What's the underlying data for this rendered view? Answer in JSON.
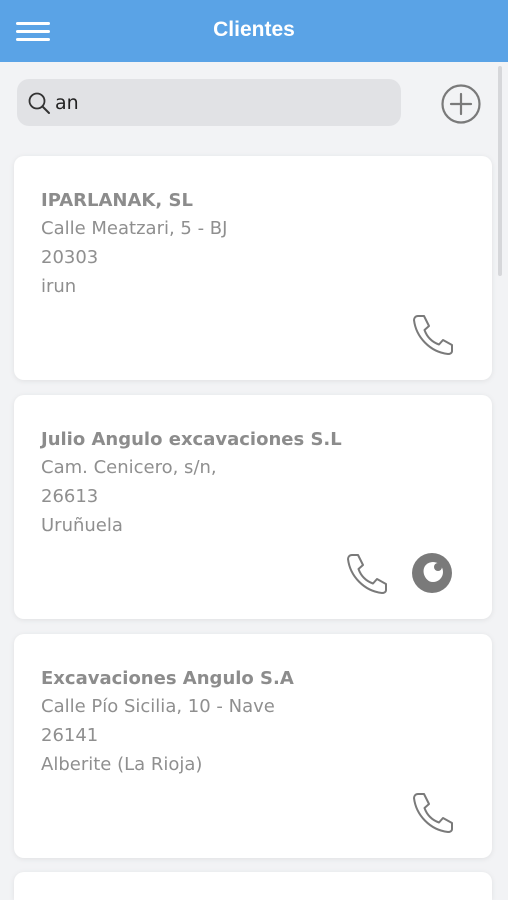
{
  "header": {
    "title": "Clientes",
    "menu_icon": "hamburger-menu-icon"
  },
  "search": {
    "value": "an",
    "icon": "search-icon"
  },
  "add_icon": "plus-circle-icon",
  "clients": [
    {
      "name": "IPARLANAK, SL",
      "address": "Calle Meatzari, 5 - BJ",
      "postal_code": "20303",
      "city": "irun",
      "actions": [
        "phone-icon"
      ]
    },
    {
      "name": "Julio Angulo excavaciones S.L",
      "address": "Cam. Cenicero, s/n,",
      "postal_code": "26613",
      "city": "Uruñuela",
      "actions": [
        "phone-icon",
        "firefox-browser-icon"
      ]
    },
    {
      "name": "Excavaciones Angulo S.A",
      "address": "Calle Pío Sicilia, 10 - Nave",
      "postal_code": "26141",
      "city": "Alberite (La Rioja)",
      "actions": [
        "phone-icon"
      ]
    }
  ],
  "colors": {
    "header": "#5aa3e6",
    "background": "#f2f3f5",
    "card_text": "#8f8f8f",
    "icon": "#7a7a7a"
  }
}
